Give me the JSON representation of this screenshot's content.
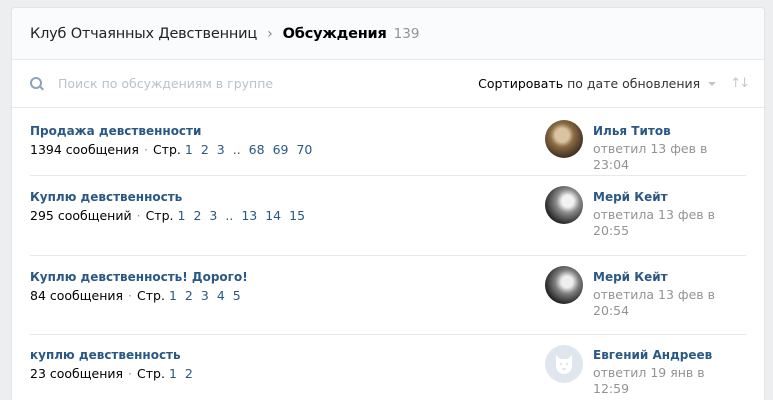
{
  "breadcrumb": {
    "group": "Клуб Отчаянных Девственниц",
    "separator": "›",
    "current": "Обсуждения",
    "count": "139"
  },
  "search": {
    "placeholder": "Поиск по обсуждениям в группе",
    "icon": "search-icon"
  },
  "sort": {
    "label": "Сортировать",
    "value": "по дате обновления",
    "direction_icon": "↑↓"
  },
  "topics": [
    {
      "title": "Продажа девственности",
      "count": "1394 сообщения",
      "pages_label": "Стр.",
      "pages": [
        "1",
        "2",
        "3",
        "..",
        "68",
        "69",
        "70"
      ],
      "author": "Илья Титов",
      "reply": "ответил 13 фев в 23:04"
    },
    {
      "title": "Куплю девственность",
      "count": "295 сообщений",
      "pages_label": "Стр.",
      "pages": [
        "1",
        "2",
        "3",
        "..",
        "13",
        "14",
        "15"
      ],
      "author": "Мерй Кейт",
      "reply": "ответила 13 фев в 20:55"
    },
    {
      "title": "Куплю девственность! Дорого!",
      "count": "84 сообщения",
      "pages_label": "Стр.",
      "pages": [
        "1",
        "2",
        "3",
        "4",
        "5"
      ],
      "author": "Мерй Кейт",
      "reply": "ответила 13 фев в 20:54"
    },
    {
      "title": "куплю девственность",
      "count": "23 сообщения",
      "pages_label": "Стр.",
      "pages": [
        "1",
        "2"
      ],
      "author": "Евгений Андреев",
      "reply": "ответил 19 янв в 12:59"
    }
  ],
  "meta_separator": "·"
}
